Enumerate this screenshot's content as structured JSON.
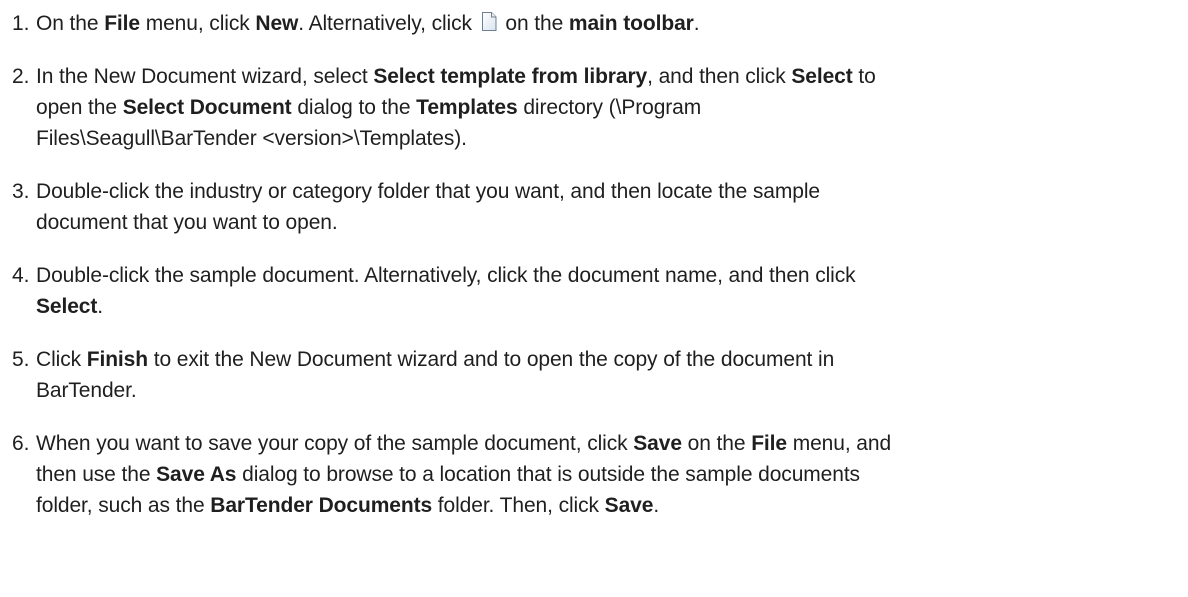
{
  "steps": [
    {
      "number": "1.",
      "parts": [
        "On the ",
        "File",
        " menu, click ",
        "New",
        ". Alternatively, click ",
        " on the ",
        "main toolbar",
        "."
      ],
      "icon": "new-document-icon"
    },
    {
      "number": "2.",
      "line1": [
        "In the New Document wizard, select ",
        "Select template from library",
        ", and then click ",
        "Select",
        " to"
      ],
      "line2": [
        "open the ",
        "Select Document",
        " dialog to the ",
        "Templates",
        " directory (\\Program"
      ],
      "line3": "Files\\Seagull\\BarTender <version>\\Templates)."
    },
    {
      "number": "3.",
      "line1": "Double-click the industry or category folder that you want, and then locate the sample",
      "line2": "document that you want to open."
    },
    {
      "number": "4.",
      "line1": "Double-click the sample document. Alternatively, click the document name, and then click",
      "line2": [
        "Select",
        "."
      ]
    },
    {
      "number": "5.",
      "line1": [
        "Click ",
        "Finish",
        " to exit the New Document wizard and to open the copy of the document in"
      ],
      "line2": "BarTender."
    },
    {
      "number": "6.",
      "line1": [
        "When you want to save your copy of the sample document, click ",
        "Save",
        " on the ",
        "File",
        " menu, and"
      ],
      "line2": [
        "then use the ",
        "Save As",
        " dialog to browse to a location that is outside the sample documents"
      ],
      "line3": [
        "folder, such as the ",
        "BarTender Documents",
        " folder. Then, click ",
        "Save",
        "."
      ]
    }
  ]
}
